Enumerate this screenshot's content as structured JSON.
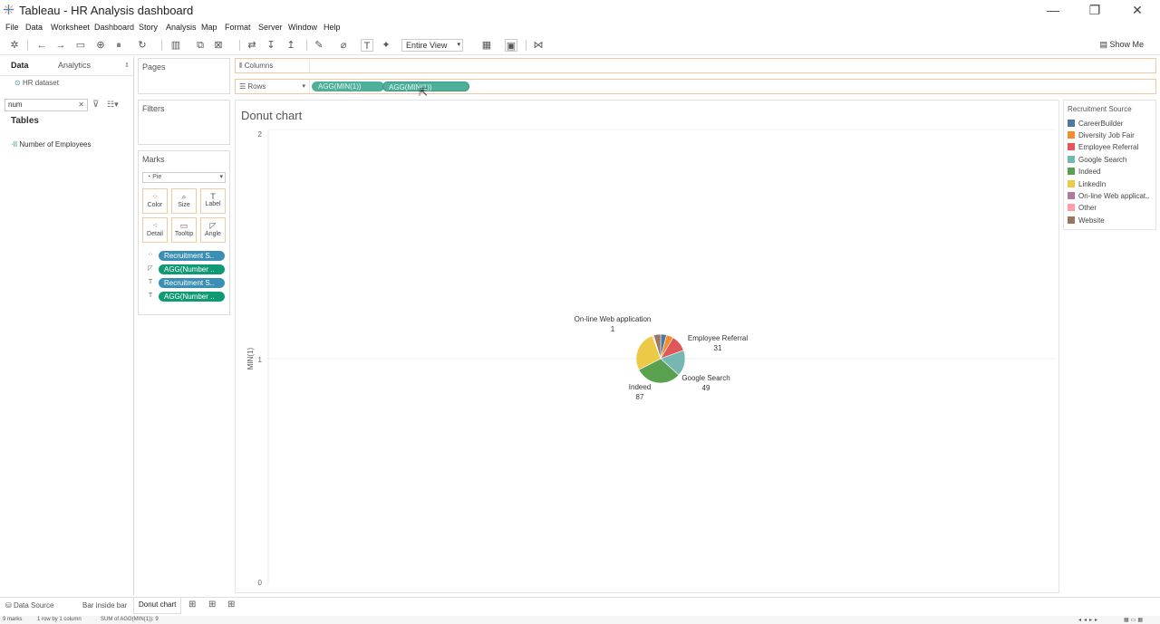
{
  "window": {
    "title": "Tableau - HR Analysis dashboard",
    "minimize": "—",
    "restore": "❐",
    "close": "✕"
  },
  "menu": [
    "File",
    "Data",
    "Worksheet",
    "Dashboard",
    "Story",
    "Analysis",
    "Map",
    "Format",
    "Server",
    "Window",
    "Help"
  ],
  "toolbar": {
    "fit_value": "Entire View",
    "show_me": "Show Me"
  },
  "left_pane": {
    "tabs": {
      "data": "Data",
      "analytics": "Analytics"
    },
    "datasource": "HR dataset",
    "search_value": "num",
    "tables_heading": "Tables",
    "fields": [
      "Number of Employees"
    ]
  },
  "cards": {
    "pages": "Pages",
    "filters": "Filters",
    "marks": "Marks",
    "mark_type": "Pie",
    "mark_buttons": {
      "color": "Color",
      "size": "Size",
      "label": "Label",
      "detail": "Detail",
      "tooltip": "Tooltip",
      "angle": "Angle"
    },
    "mark_pills": [
      "Recruitment S..",
      "AGG(Number ..",
      "Recruitment S..",
      "AGG(Number .."
    ]
  },
  "shelves": {
    "columns_label": "Columns",
    "rows_label": "Rows",
    "row_pills": [
      "AGG(MIN(1))",
      "AGG(MIN(1))"
    ]
  },
  "view": {
    "title": "Donut chart",
    "axis_label": "MIN(1)",
    "ticks": [
      "2",
      "1",
      "0"
    ]
  },
  "chart_data": {
    "type": "pie",
    "title": "Donut chart",
    "ylabel": "MIN(1)",
    "ylim": [
      0,
      2
    ],
    "center_y": 1,
    "slices": [
      {
        "name": "CareerBuilder",
        "value": 11,
        "color": "#4e79a7"
      },
      {
        "name": "Diversity Job Fair",
        "value": 13,
        "color": "#f28e2b"
      },
      {
        "name": "Employee Referral",
        "value": 31,
        "color": "#e15759"
      },
      {
        "name": "Google Search",
        "value": 49,
        "color": "#76b7b2"
      },
      {
        "name": "Indeed",
        "value": 87,
        "color": "#59a14f"
      },
      {
        "name": "LinkedIn",
        "value": 76,
        "color": "#edc948"
      },
      {
        "name": "On-line Web application",
        "value": 1,
        "color": "#b07aa1"
      },
      {
        "name": "Other",
        "value": 2,
        "color": "#ff9da7"
      },
      {
        "name": "Website",
        "value": 13,
        "color": "#9c755f"
      }
    ],
    "labels": [
      {
        "name": "On-line Web application",
        "value": "1"
      },
      {
        "name": "Employee Referral",
        "value": "31"
      },
      {
        "name": "Google Search",
        "value": "49"
      },
      {
        "name": "Indeed",
        "value": "87"
      }
    ]
  },
  "legend": {
    "title": "Recruitment Source",
    "items": [
      {
        "label": "CareerBuilder",
        "color": "#4e79a7"
      },
      {
        "label": "Diversity Job Fair",
        "color": "#f28e2b"
      },
      {
        "label": "Employee Referral",
        "color": "#e15759"
      },
      {
        "label": "Google Search",
        "color": "#76b7b2"
      },
      {
        "label": "Indeed",
        "color": "#59a14f"
      },
      {
        "label": "LinkedIn",
        "color": "#edc948"
      },
      {
        "label": "On-line Web applicat..",
        "color": "#b07aa1"
      },
      {
        "label": "Other",
        "color": "#ff9da7"
      },
      {
        "label": "Website",
        "color": "#9c755f"
      }
    ]
  },
  "sheet_tabs": {
    "datasource": "Data Source",
    "tabs": [
      "Bar inside bar",
      "Donut chart"
    ],
    "active": "Donut chart"
  },
  "status": {
    "marks": "9 marks",
    "dims": "1 row by 1 column",
    "sum": "SUM of AGG(MIN(1)): 9"
  }
}
